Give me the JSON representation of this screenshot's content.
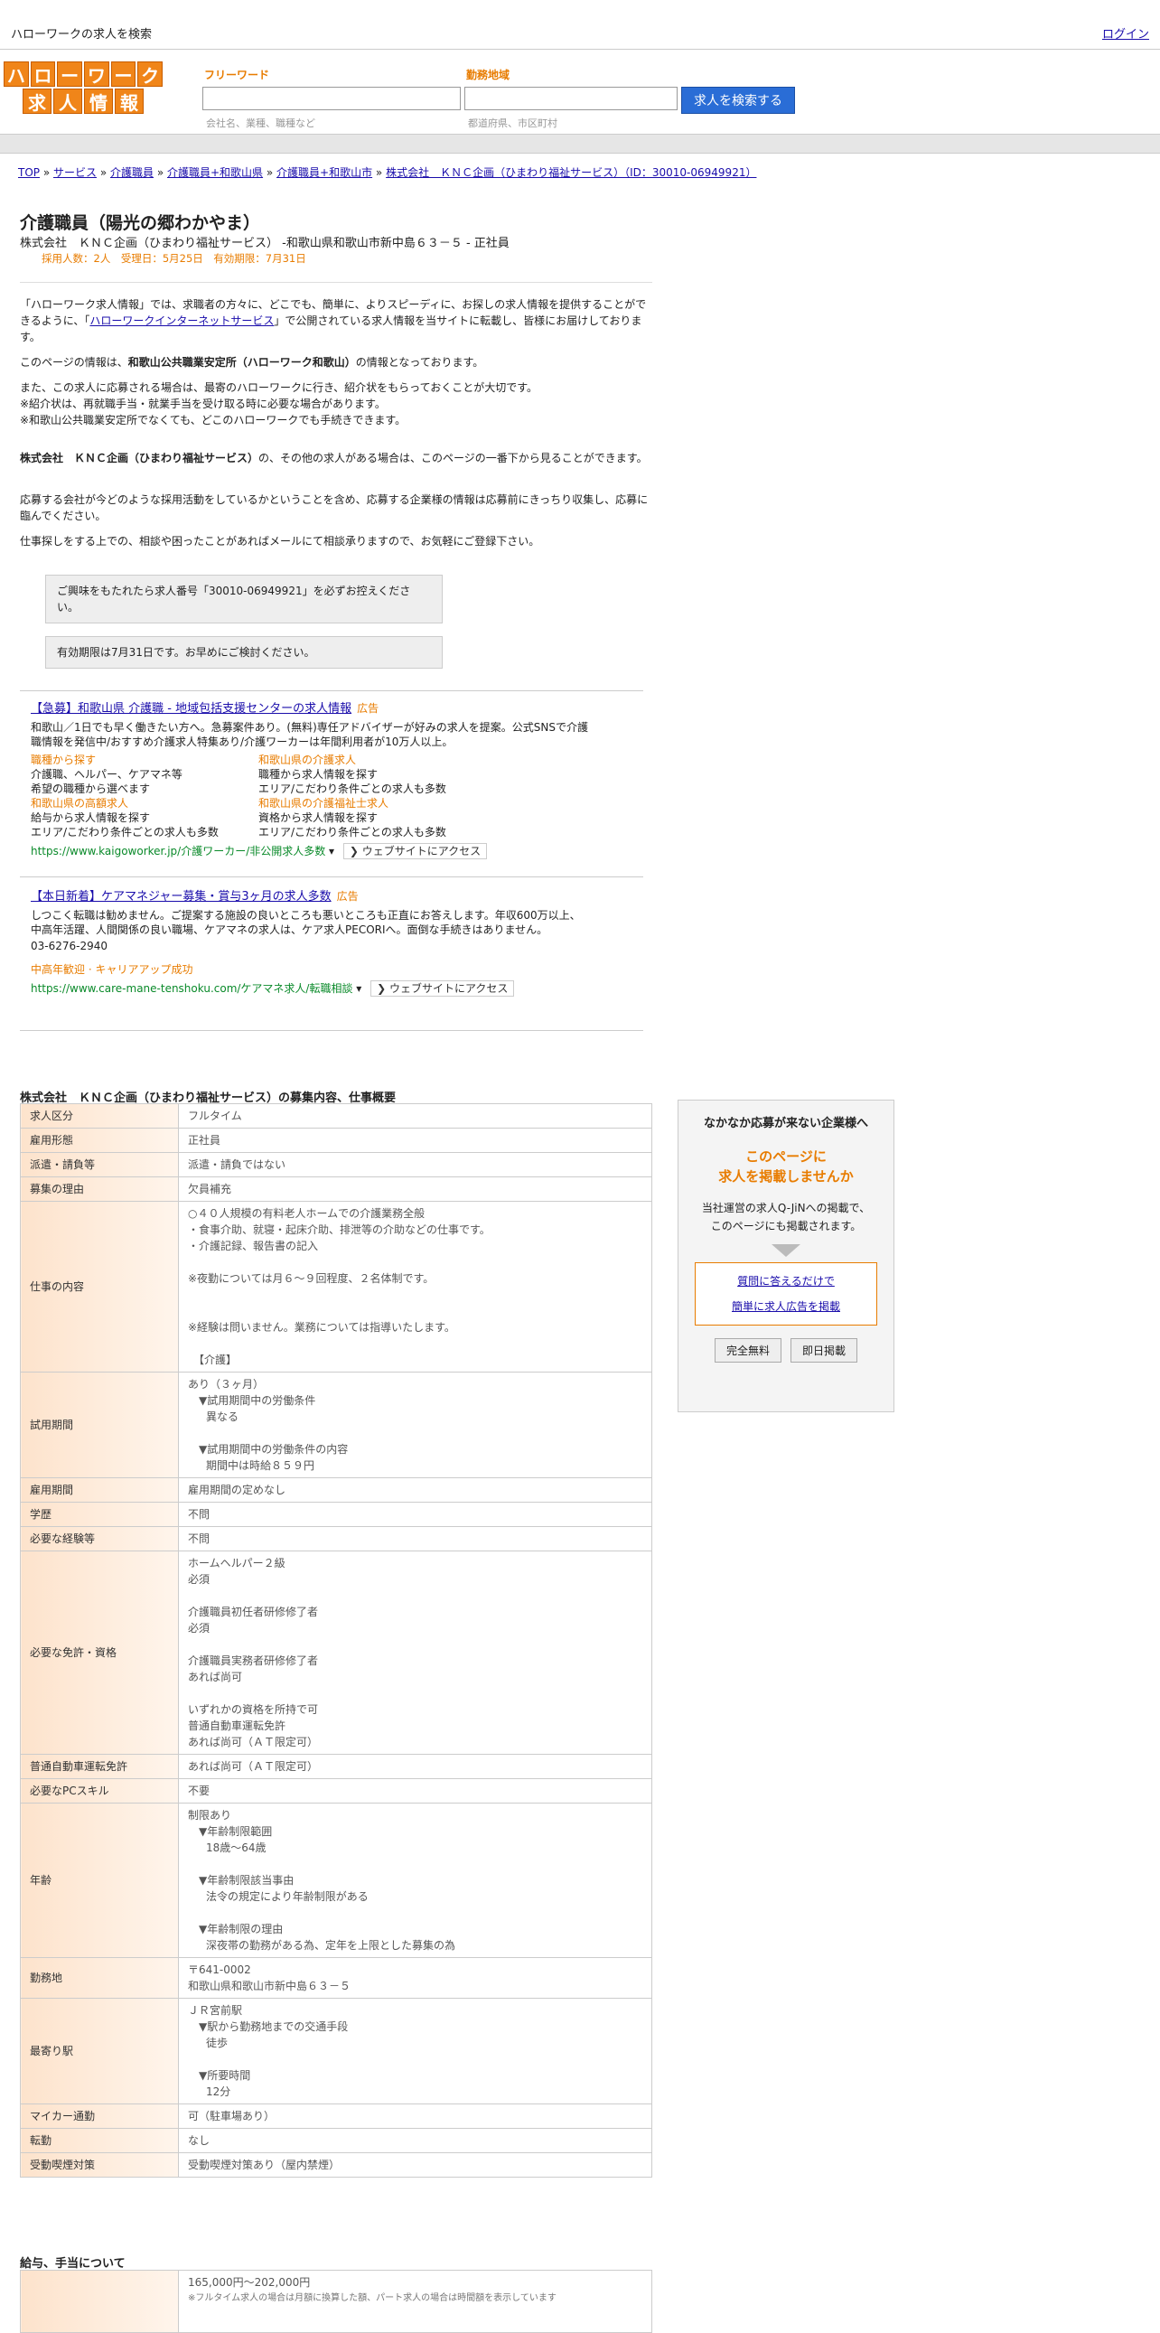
{
  "topbar": {
    "title": "ハローワークの求人を検索",
    "login": "ログイン"
  },
  "logo": {
    "row1": [
      "ハ",
      "ロ",
      "ー",
      "ワ",
      "ー",
      "ク"
    ],
    "row2": [
      "求",
      "人",
      "情",
      "報"
    ]
  },
  "search": {
    "free_label": "フリーワード",
    "free_hint": "会社名、業種、職種など",
    "area_label": "勤務地域",
    "area_hint": "都道府県、市区町村",
    "button": "求人を検索する"
  },
  "breadcrumb": [
    "TOP",
    "サービス",
    "介護職員",
    "介護職員+和歌山県",
    "介護職員+和歌山市",
    "株式会社　ＫＮＣ企画（ひまわり福祉サービス）（ID：30010-06949921）"
  ],
  "job": {
    "title": "介護職員（陽光の郷わかやま）",
    "company_line": "株式会社　ＫＮＣ企画（ひまわり福祉サービス） -和歌山県和歌山市新中島６３－５ - 正社員",
    "meta": "採用人数：2人　受理日：5月25日　有効期限：7月31日"
  },
  "intro": {
    "p1a": "「ハローワーク求人情報」では、求職者の方々に、どこでも、簡単に、よりスピーディに、お探しの求人情報を提供することができるように、「",
    "p1link": "ハローワークインターネットサービス",
    "p1b": "」で公開されている求人情報を当サイトに転載し、皆様にお届けしております。",
    "p2a": "このページの情報は、",
    "p2b": "和歌山公共職業安定所（ハローワーク和歌山）",
    "p2c": "の情報となっております。",
    "p3": [
      "また、この求人に応募される場合は、最寄のハローワークに行き、紹介状をもらっておくことが大切です。",
      "※紹介状は、再就職手当・就業手当を受け取る時に必要な場合があります。",
      "※和歌山公共職業安定所でなくても、どこのハローワークでも手続きできます。"
    ],
    "p4a": "株式会社　ＫＮＣ企画（ひまわり福祉サービス）",
    "p4b": "の、その他の求人がある場合は、このページの一番下から見ることができます。",
    "p5": "応募する会社が今どのような採用活動をしているかということを含め、応募する企業様の情報は応募前にきっちり収集し、応募に臨んでください。",
    "p6": "仕事探しをする上での、相談や困ったことがあればメールにて相談承りますので、お気軽にご登録下さい。",
    "note1": "ご興味をもたれたら求人番号「30010-06949921」を必ずお控えください。",
    "note2": "有効期限は7月31日です。お早めにご検討ください。"
  },
  "ads": [
    {
      "title": "【急募】和歌山県 介護職 - 地域包括支援センターの求人情報",
      "tag": "広告",
      "desc": "和歌山／1日でも早く働きたい方へ。急募案件あり。(無料)専任アドバイザーが好みの求人を提案。公式SNSで介護職情報を発信中/おすすめ介護求人特集あり/介護ワーカーは年間利用者が10万人以上。",
      "links": [
        {
          "head": "職種から探す",
          "l1": "介護職、ヘルパー、ケアマネ等",
          "l2": "希望の職種から選べます"
        },
        {
          "head": "和歌山県の介護求人",
          "l1": "職種から求人情報を探す",
          "l2": "エリア/こだわり条件ごとの求人も多数"
        },
        {
          "head": "和歌山県の高額求人",
          "l1": "給与から求人情報を探す",
          "l2": "エリア/こだわり条件ごとの求人も多数"
        },
        {
          "head": "和歌山県の介護福祉士求人",
          "l1": "資格から求人情報を探す",
          "l2": "エリア/こだわり条件ごとの求人も多数"
        }
      ],
      "url": "https://www.kaigoworker.jp/介護ワーカー/非公開求人多数",
      "visit": "ウェブサイトにアクセス"
    },
    {
      "title": "【本日新着】ケアマネジャー募集・賞与3ヶ月の求人多数",
      "tag": "広告",
      "desc": "しつこく転職は勧めません。ご提案する施設の良いところも悪いところも正直にお答えします。年収600万以上、中高年活躍、人間関係の良い職場、ケアマネの求人は、ケア求人PECORIへ。面倒な手続きはありません。",
      "phone": "03-6276-2940",
      "sub": "中高年歓迎 · キャリアアップ成功",
      "url": "https://www.care-mane-tenshoku.com/ケアマネ求人/転職相談",
      "visit": "ウェブサイトにアクセス"
    }
  ],
  "section1": {
    "head": "株式会社　ＫＮＣ企画（ひまわり福祉サービス）の募集内容、仕事概要",
    "rows": [
      {
        "k": "求人区分",
        "v": [
          "フルタイム"
        ]
      },
      {
        "k": "雇用形態",
        "v": [
          "正社員"
        ]
      },
      {
        "k": "派遣・請負等",
        "v": [
          "派遣・請負ではない"
        ]
      },
      {
        "k": "募集の理由",
        "v": [
          "欠員補充"
        ]
      },
      {
        "k": "仕事の内容",
        "v": [
          "○４０人規模の有料老人ホームでの介護業務全般",
          "・食事介助、就寝・起床介助、排泄等の介助などの仕事です。",
          "・介護記録、報告書の記入",
          "",
          "※夜勤については月６～９回程度、２名体制です。",
          "",
          "",
          "※経験は問いません。業務については指導いたします。",
          "",
          "　【介護】"
        ]
      },
      {
        "k": "試用期間",
        "v": [
          "あり（３ヶ月）",
          "▼試用期間中の労働条件",
          "異なる",
          "",
          "▼試用期間中の労働条件の内容",
          "期間中は時給８５９円"
        ]
      },
      {
        "k": "雇用期間",
        "v": [
          "雇用期間の定めなし"
        ]
      },
      {
        "k": "学歴",
        "v": [
          "不問"
        ]
      },
      {
        "k": "必要な経験等",
        "v": [
          "不問"
        ]
      },
      {
        "k": "必要な免許・資格",
        "v": [
          "ホームヘルパー２級",
          "必須",
          "",
          "介護職員初任者研修修了者",
          "必須",
          "",
          "介護職員実務者研修修了者",
          "あれば尚可",
          "",
          "いずれかの資格を所持で可",
          "普通自動車運転免許",
          "あれば尚可（ＡＴ限定可）"
        ]
      },
      {
        "k": "普通自動車運転免許",
        "v": [
          "あれば尚可（ＡＴ限定可）"
        ]
      },
      {
        "k": "必要なPCスキル",
        "v": [
          "不要"
        ]
      },
      {
        "k": "年齢",
        "v": [
          "制限あり",
          "▼年齢制限範囲",
          "18歳〜64歳",
          "",
          "▼年齢制限該当事由",
          "法令の規定により年齢制限がある",
          "",
          "▼年齢制限の理由",
          "深夜帯の勤務がある為、定年を上限とした募集の為"
        ]
      },
      {
        "k": "勤務地",
        "v": [
          "〒641-0002",
          "和歌山県和歌山市新中島６３－５"
        ]
      },
      {
        "k": "最寄り駅",
        "v": [
          "ＪＲ宮前駅",
          "▼駅から勤務地までの交通手段",
          "徒歩",
          "",
          "▼所要時間",
          "12分"
        ]
      },
      {
        "k": "マイカー通勤",
        "v": [
          "可（駐車場あり）"
        ]
      },
      {
        "k": "転勤",
        "v": [
          "なし"
        ]
      },
      {
        "k": "受動喫煙対策",
        "v": [
          "受動喫煙対策あり（屋内禁煙）"
        ]
      }
    ]
  },
  "section2": {
    "head": "給与、手当について",
    "salary": "165,000円〜202,000円",
    "salary_note": "※フルタイム求人の場合は月額に換算した額、パート求人の場合は時間額を表示しています"
  },
  "side": {
    "head": "なかなか応募が来ない企業様へ",
    "orange1": "このページに",
    "orange2": "求人を掲載しませんか",
    "desc1": "当社運営の求人Q-JiNへの掲載で、",
    "desc2": "このページにも掲載されます。",
    "link1": "質問に答えるだけで",
    "link2": "簡単に求人広告を掲載",
    "btn1": "完全無料",
    "btn2": "即日掲載"
  }
}
